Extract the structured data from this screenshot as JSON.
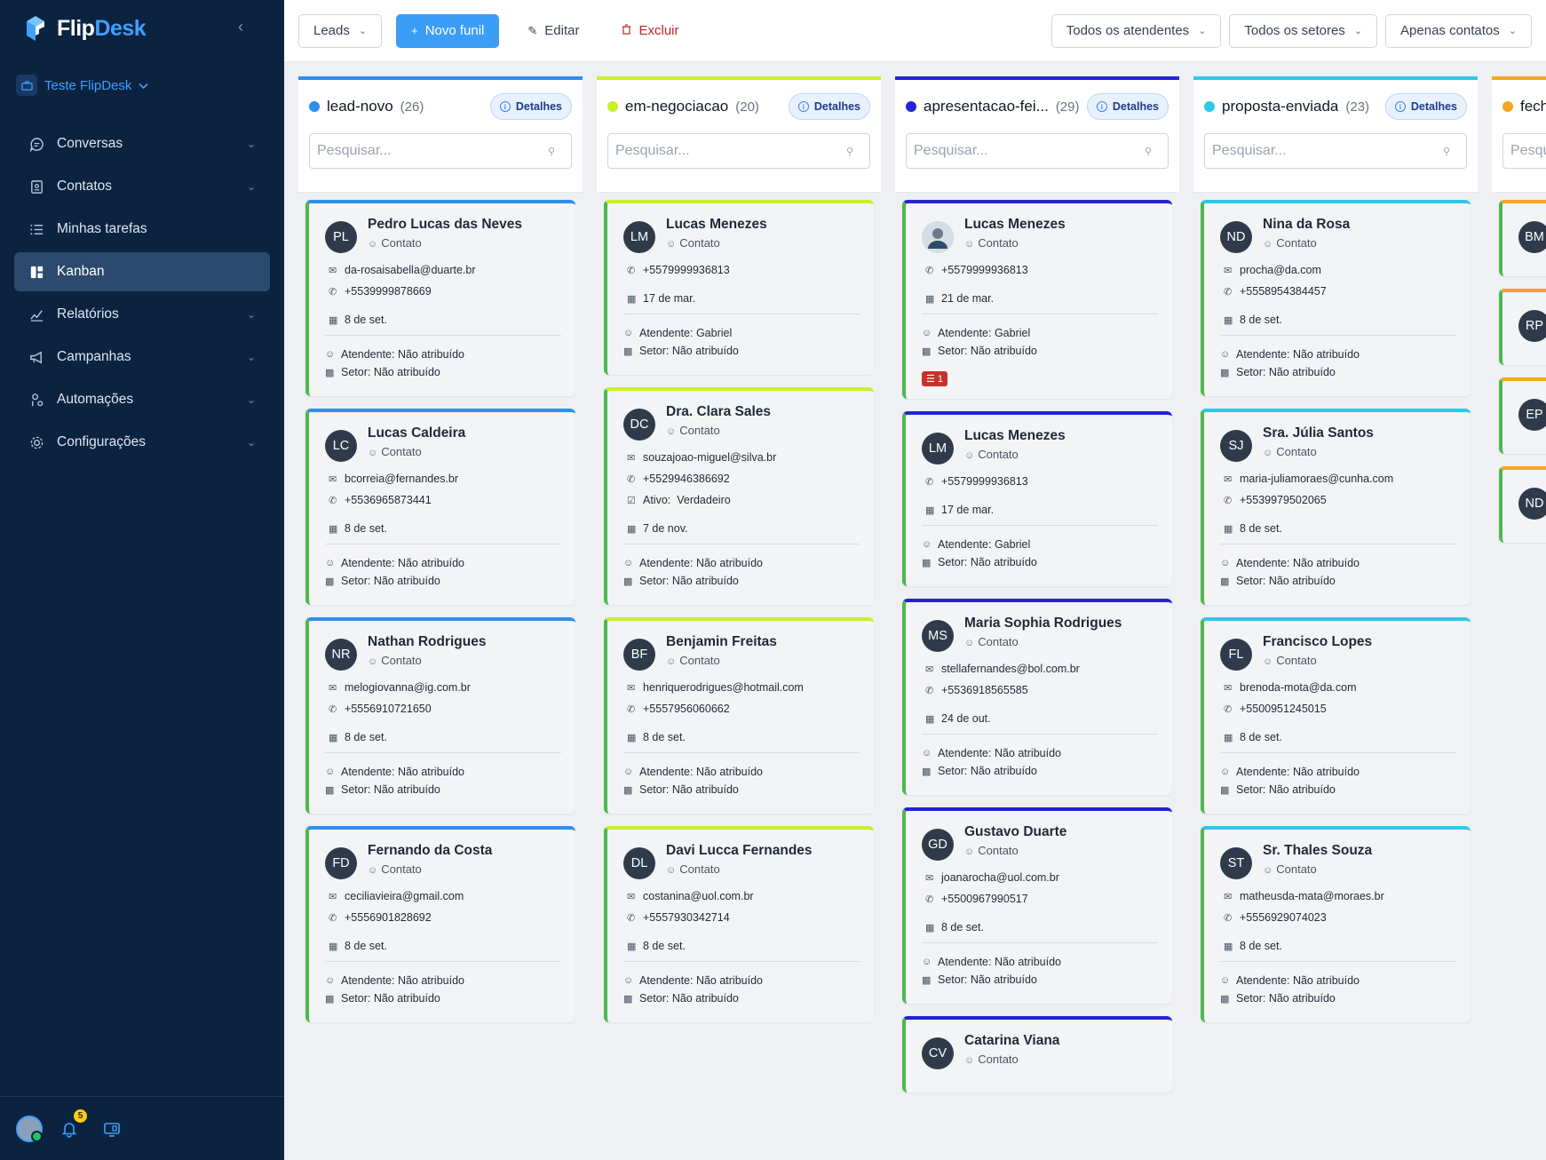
{
  "brand": {
    "name_part1": "Flip",
    "name_part2": "Desk"
  },
  "workspace": {
    "label": "Teste FlipDesk"
  },
  "nav": [
    {
      "label": "Conversas",
      "icon": "chat-icon",
      "has_chevron": true
    },
    {
      "label": "Contatos",
      "icon": "contact-card-icon",
      "has_chevron": true
    },
    {
      "label": "Minhas tarefas",
      "icon": "task-list-icon",
      "has_chevron": false
    },
    {
      "label": "Kanban",
      "icon": "kanban-icon",
      "has_chevron": false,
      "active": true
    },
    {
      "label": "Relatórios",
      "icon": "chart-icon",
      "has_chevron": true
    },
    {
      "label": "Campanhas",
      "icon": "megaphone-icon",
      "has_chevron": true
    },
    {
      "label": "Automações",
      "icon": "automation-icon",
      "has_chevron": true
    },
    {
      "label": "Configurações",
      "icon": "gear-icon",
      "has_chevron": true
    }
  ],
  "footer": {
    "notification_count": "5"
  },
  "toolbar": {
    "funnel_select": "Leads",
    "new_funnel": "Novo funil",
    "edit": "Editar",
    "delete": "Excluir",
    "filter_agents": "Todos os atendentes",
    "filter_sectors": "Todos os setores",
    "filter_contacts": "Apenas contatos"
  },
  "colors": {
    "sidebar": "#0c2340",
    "accent": "#3b9df5",
    "card_left": "#4db84d"
  },
  "labels": {
    "details": "Detalhes",
    "search_placeholder": "Pesquisar...",
    "contact_type": "Contato"
  },
  "columns": [
    {
      "title": "lead-novo",
      "count": "(26)",
      "color": "#2d8ff0",
      "cards": [
        {
          "initials": "PL",
          "name": "Pedro Lucas das Neves",
          "email": "da-rosaisabella@duarte.br",
          "phone": "+5539999878669",
          "date": "8 de set.",
          "agent": "Atendente: Não atribuído",
          "sector": "Setor: Não atribuído"
        },
        {
          "initials": "LC",
          "name": "Lucas Caldeira",
          "email": "bcorreia@fernandes.br",
          "phone": "+5536965873441",
          "date": "8 de set.",
          "agent": "Atendente: Não atribuído",
          "sector": "Setor: Não atribuído"
        },
        {
          "initials": "NR",
          "name": "Nathan Rodrigues",
          "email": "melogiovanna@ig.com.br",
          "phone": "+5556910721650",
          "date": "8 de set.",
          "agent": "Atendente: Não atribuído",
          "sector": "Setor: Não atribuído"
        },
        {
          "initials": "FD",
          "name": "Fernando da Costa",
          "email": "ceciliavieira@gmail.com",
          "phone": "+5556901828692",
          "date": "8 de set.",
          "agent": "Atendente: Não atribuído",
          "sector": "Setor: Não atribuído"
        }
      ]
    },
    {
      "title": "em-negociacao",
      "count": "(20)",
      "color": "#c8f02a",
      "cards": [
        {
          "initials": "LM",
          "name": "Lucas Menezes",
          "phone": "+5579999936813",
          "date": "17 de mar.",
          "agent": "Atendente: Gabriel",
          "sector": "Setor: Não atribuído"
        },
        {
          "initials": "DC",
          "name": "Dra. Clara Sales",
          "email": "souzajoao-miguel@silva.br",
          "phone": "+5529946386692",
          "active_label": "Ativo:",
          "active_value": "Verdadeiro",
          "date": "7 de nov.",
          "agent": "Atendente: Não atribuído",
          "sector": "Setor: Não atribuído"
        },
        {
          "initials": "BF",
          "name": "Benjamin Freitas",
          "email": "henriquerodrigues@hotmail.com",
          "phone": "+5557956060662",
          "date": "8 de set.",
          "agent": "Atendente: Não atribuído",
          "sector": "Setor: Não atribuído"
        },
        {
          "initials": "DL",
          "name": "Davi Lucca Fernandes",
          "email": "costanina@uol.com.br",
          "phone": "+5557930342714",
          "date": "8 de set.",
          "agent": "Atendente: Não atribuído",
          "sector": "Setor: Não atribuído"
        }
      ]
    },
    {
      "title": "apresentacao-fei...",
      "count": "(29)",
      "color": "#2424d6",
      "cards": [
        {
          "initials": "",
          "photo": true,
          "name": "Lucas Menezes",
          "phone": "+5579999936813",
          "date": "21 de mar.",
          "agent": "Atendente: Gabriel",
          "sector": "Setor: Não atribuído",
          "tasks": "1"
        },
        {
          "initials": "LM",
          "name": "Lucas Menezes",
          "phone": "+5579999936813",
          "date": "17 de mar.",
          "agent": "Atendente: Gabriel",
          "sector": "Setor: Não atribuído"
        },
        {
          "initials": "MS",
          "name": "Maria Sophia Rodrigues",
          "email": "stellafernandes@bol.com.br",
          "phone": "+5536918565585",
          "date": "24 de out.",
          "agent": "Atendente: Não atribuído",
          "sector": "Setor: Não atribuído"
        },
        {
          "initials": "GD",
          "name": "Gustavo Duarte",
          "email": "joanarocha@uol.com.br",
          "phone": "+5500967990517",
          "date": "8 de set.",
          "agent": "Atendente: Não atribuído",
          "sector": "Setor: Não atribuído"
        },
        {
          "initials": "CV",
          "name": "Catarina Viana"
        }
      ]
    },
    {
      "title": "proposta-enviada",
      "count": "(23)",
      "color": "#2cc9e8",
      "cards": [
        {
          "initials": "ND",
          "name": "Nina da Rosa",
          "email": "procha@da.com",
          "phone": "+5558954384457",
          "date": "8 de set.",
          "agent": "Atendente: Não atribuído",
          "sector": "Setor: Não atribuído"
        },
        {
          "initials": "SJ",
          "name": "Sra. Júlia Santos",
          "email": "maria-juliamoraes@cunha.com",
          "phone": "+5539979502065",
          "date": "8 de set.",
          "agent": "Atendente: Não atribuído",
          "sector": "Setor: Não atribuído"
        },
        {
          "initials": "FL",
          "name": "Francisco Lopes",
          "email": "brenoda-mota@da.com",
          "phone": "+5500951245015",
          "date": "8 de set.",
          "agent": "Atendente: Não atribuído",
          "sector": "Setor: Não atribuído"
        },
        {
          "initials": "ST",
          "name": "Sr. Thales Souza",
          "email": "matheusda-mata@moraes.br",
          "phone": "+5556929074023",
          "date": "8 de set.",
          "agent": "Atendente: Não atribuído",
          "sector": "Setor: Não atribuído"
        }
      ]
    },
    {
      "title": "fechado",
      "count": "",
      "color": "#f5a623",
      "cards": [
        {
          "initials": "BM",
          "name": ""
        },
        {
          "initials": "RP",
          "name": ""
        },
        {
          "initials": "EP",
          "name": ""
        },
        {
          "initials": "ND",
          "name": ""
        }
      ]
    }
  ]
}
